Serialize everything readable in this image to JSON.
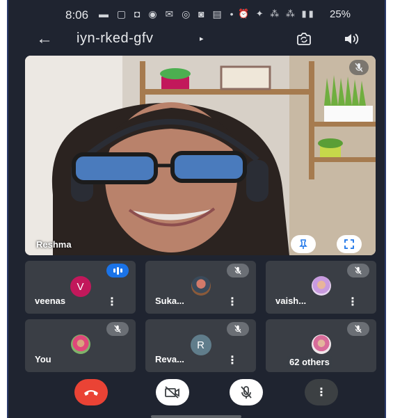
{
  "status_bar": {
    "time": "8:06",
    "left_icons": "▬ ▢ ◘ ◉ ✉ ◎ ◙ ▤ •",
    "right_icons": "⏰ ✦ ⁂ ⁂ ▮▮",
    "battery": "25%"
  },
  "header": {
    "back_icon": "arrow-left",
    "meeting_code": "iyn-rked-gfv",
    "expand_icon": "▸"
  },
  "main_video": {
    "participant_name": "Reshma"
  },
  "tiles": [
    {
      "name": "veenas",
      "avatar_type": "letter",
      "avatar_letter": "V",
      "avatar_color": "#c2185b",
      "status": "speaking"
    },
    {
      "name": "Suka...",
      "avatar_type": "photo",
      "status": "muted"
    },
    {
      "name": "vaish...",
      "avatar_type": "photo",
      "status": "muted"
    },
    {
      "name": "You",
      "avatar_type": "photo",
      "status": "muted"
    },
    {
      "name": "Reva...",
      "avatar_type": "letter",
      "avatar_letter": "R",
      "avatar_color": "#607d8b",
      "status": "muted"
    },
    {
      "name": "62 others",
      "avatar_type": "photo",
      "status": "muted"
    }
  ],
  "controls": {
    "more_label": "⋮"
  },
  "colors": {
    "background": "#1f2430",
    "tile": "#3a3e45",
    "end_call": "#ea4335",
    "speaking": "#1a73e8"
  }
}
